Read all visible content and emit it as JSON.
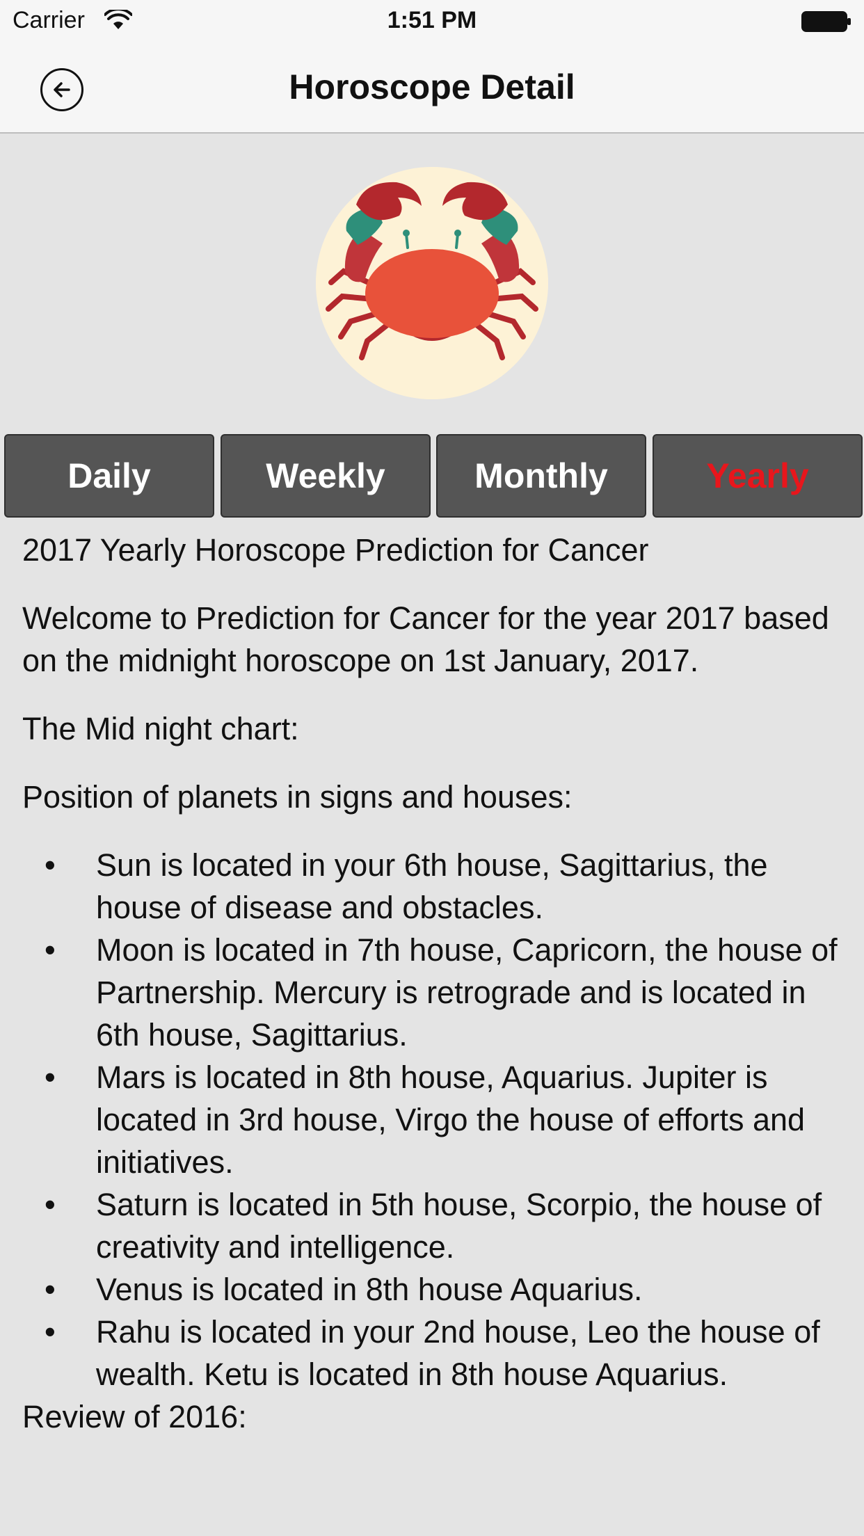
{
  "status_bar": {
    "carrier": "Carrier",
    "time": "1:51 PM"
  },
  "nav": {
    "title": "Horoscope Detail",
    "back_icon": "back-arrow-circle-icon"
  },
  "zodiac": {
    "icon": "cancer-crab-icon"
  },
  "tabs": [
    {
      "label": "Daily",
      "active": false
    },
    {
      "label": "Weekly",
      "active": false
    },
    {
      "label": "Monthly",
      "active": false
    },
    {
      "label": "Yearly",
      "active": true
    }
  ],
  "colors": {
    "active_tab_text": "#e8161c",
    "tab_background": "#555555",
    "page_background": "#e4e4e4"
  },
  "content": {
    "heading": "2017 Yearly Horoscope Prediction for Cancer",
    "intro": "Welcome to Prediction for Cancer for the year 2017 based on the midnight horoscope on 1st January, 2017.",
    "chart_label": "The Mid night chart:",
    "positions_label": "Position of planets in signs and houses:",
    "bullets": [
      "Sun is located in your 6th house, Sagittarius, the house of disease and obstacles.",
      "Moon is located in 7th house, Capricorn, the house of Partnership. Mercury is retrograde and is located in 6th house, Sagittarius.",
      "Mars is located in 8th house, Aquarius. Jupiter is located in 3rd house, Virgo the house of efforts and initiatives.",
      "Saturn is located in 5th house, Scorpio, the house of creativity and intelligence.",
      "Venus is located in 8th house Aquarius.",
      "Rahu is located in your 2nd house, Leo the house of wealth. Ketu is located in 8th house Aquarius."
    ],
    "review_label": "Review of 2016:"
  }
}
